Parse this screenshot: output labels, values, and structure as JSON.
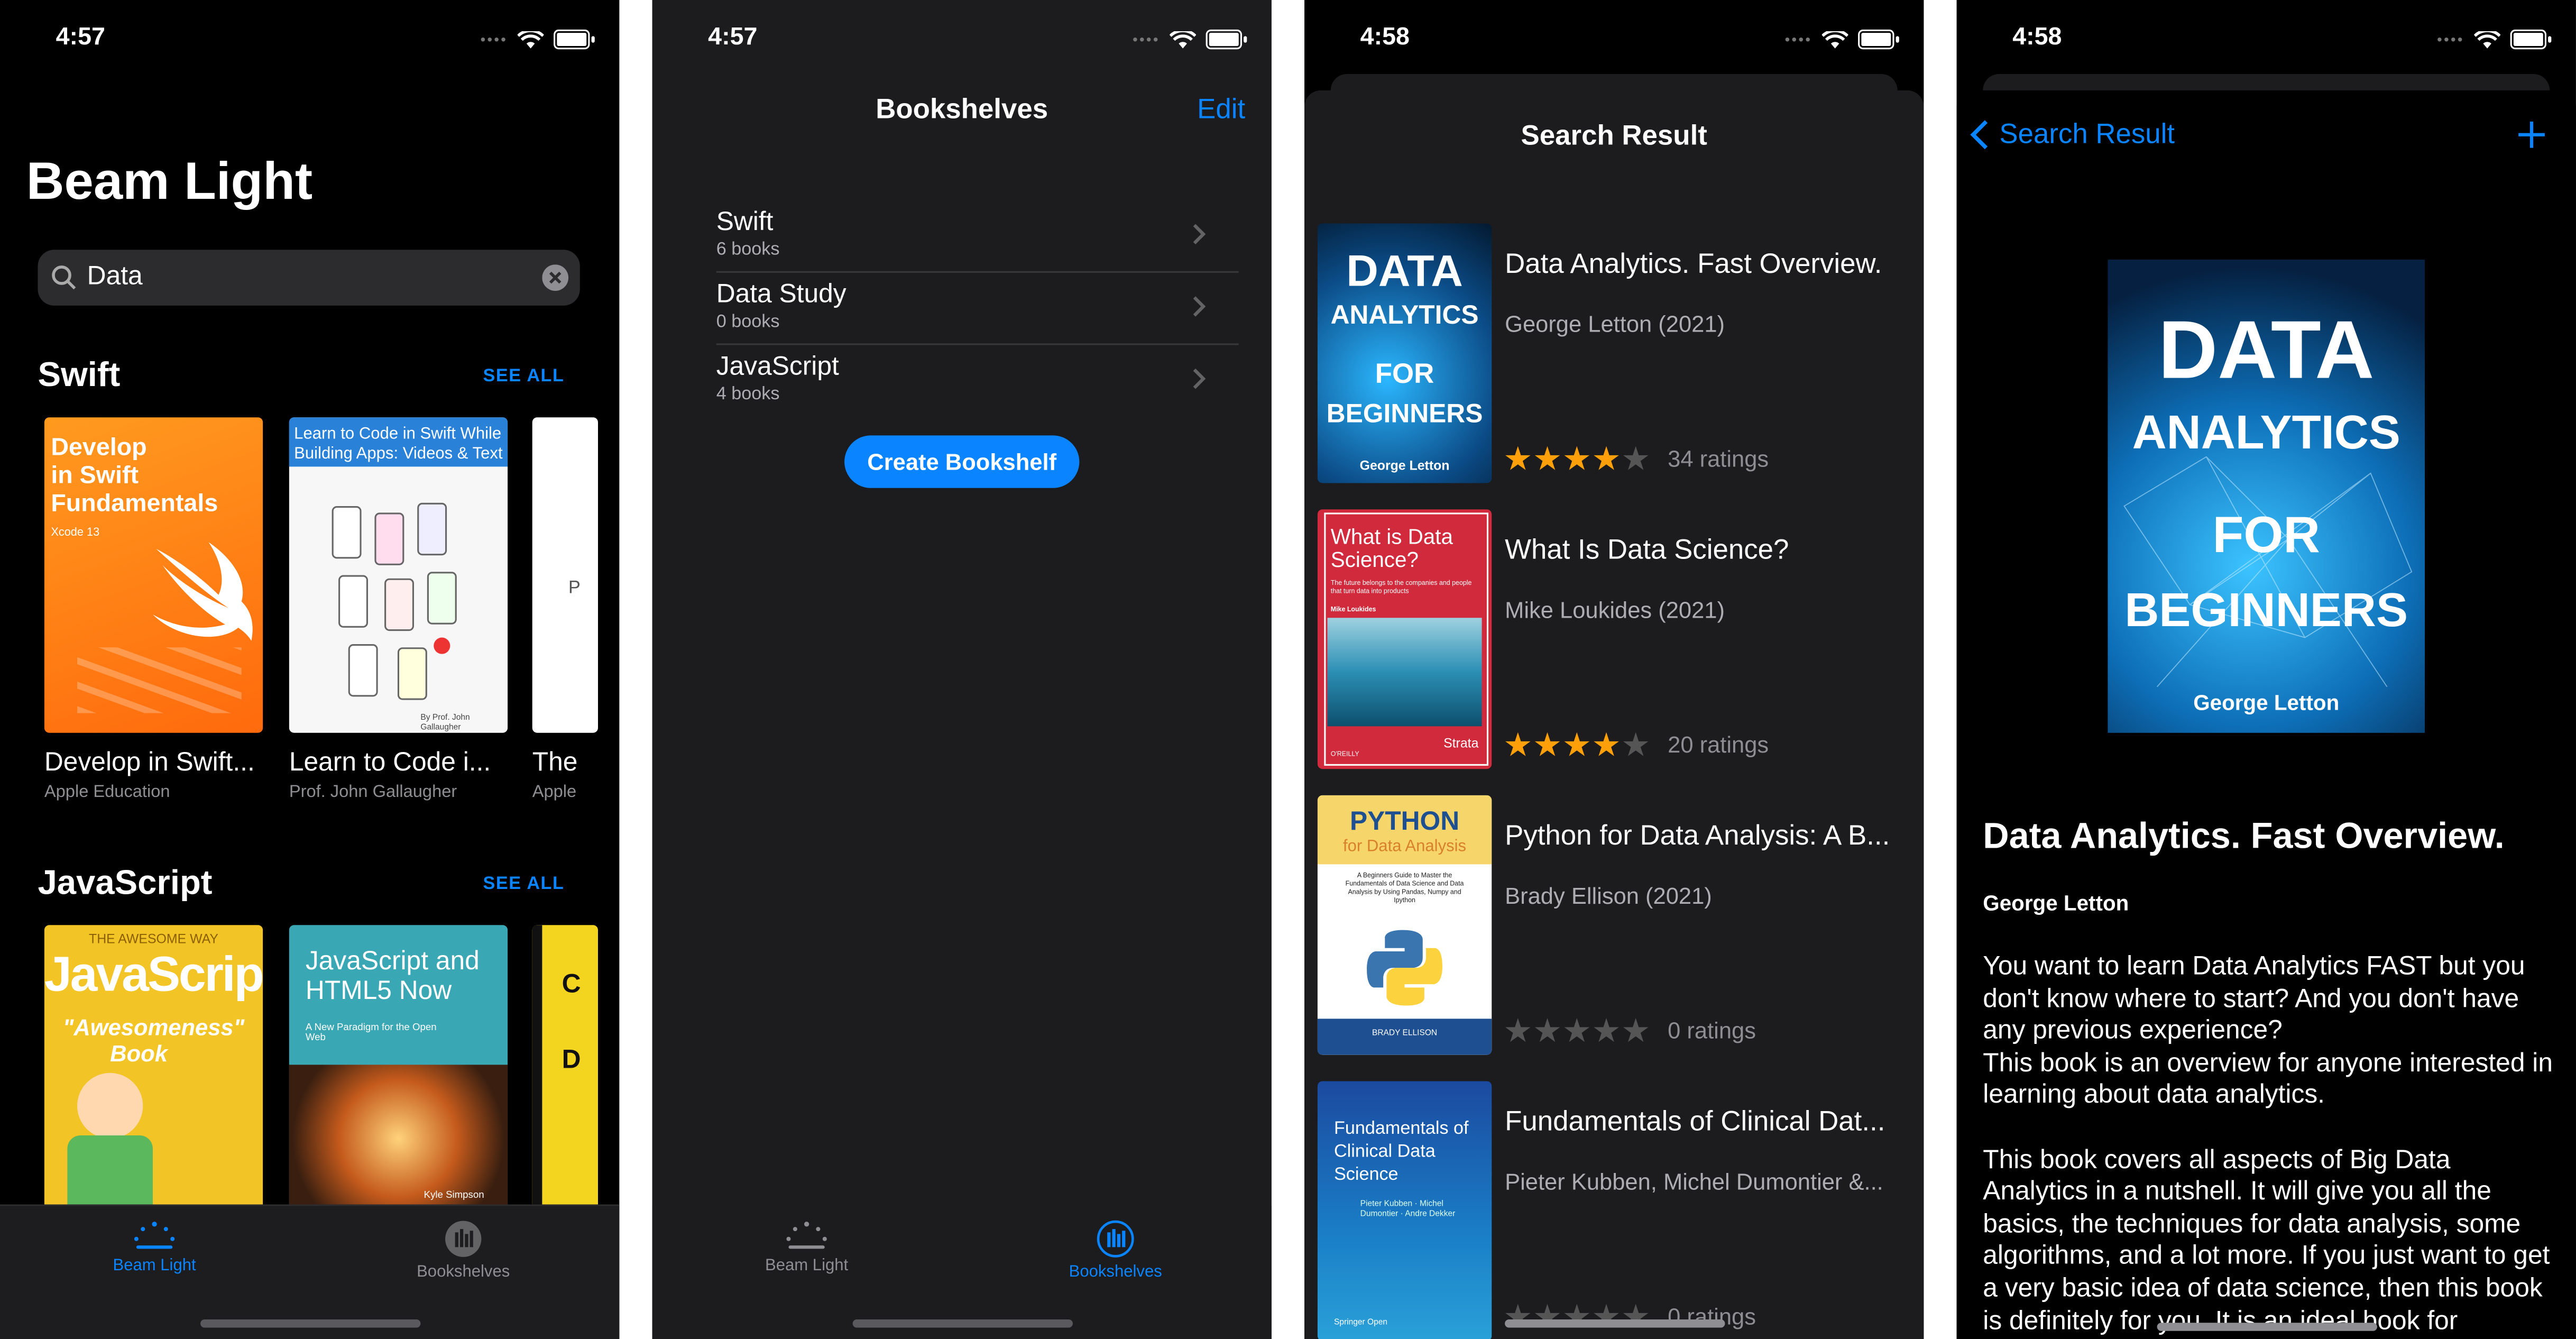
{
  "colors": {
    "accent": "#0a84ff",
    "star": "#ff9f0a",
    "background": "#000000",
    "card": "#1c1c1e"
  },
  "screen1": {
    "time": "4:57",
    "title": "Beam Light",
    "search_value": "Data",
    "sections": [
      {
        "title": "Swift",
        "see_all": "SEE ALL",
        "books": [
          {
            "title": "Develop in Swift...",
            "author": "Apple Education"
          },
          {
            "title": "Learn to Code i...",
            "author": "Prof. John Gallaugher"
          },
          {
            "title": "The",
            "author": "Apple"
          }
        ]
      },
      {
        "title": "JavaScript",
        "see_all": "SEE ALL"
      }
    ],
    "covers": {
      "swift": {
        "line1": "Develop",
        "line2": "in Swift",
        "line3": "Fundamentals",
        "edition": "Xcode 13"
      },
      "learn": {
        "line1": "Learn to Code in Swift While",
        "line2": "Building Apps: Videos & Text",
        "by": "By Prof. John Gallaugher"
      },
      "js1": {
        "top": "THE AWESOME WAY",
        "main": "JavaScript",
        "sub": "\"Awesomeness\"",
        "sub2": "Book"
      },
      "js2": {
        "main": "JavaScript and HTML5 Now",
        "sub": "A New Paradigm for the Open Web",
        "author": "Kyle Simpson"
      }
    },
    "tabs": [
      {
        "label": "Beam Light",
        "active": true
      },
      {
        "label": "Bookshelves",
        "active": false
      }
    ]
  },
  "screen2": {
    "time": "4:57",
    "title": "Bookshelves",
    "edit": "Edit",
    "shelves": [
      {
        "name": "Swift",
        "count": "6 books"
      },
      {
        "name": "Data Study",
        "count": "0 books"
      },
      {
        "name": "JavaScript",
        "count": "4 books"
      }
    ],
    "create_button": "Create Bookshelf",
    "tabs": [
      {
        "label": "Beam Light",
        "active": false
      },
      {
        "label": "Bookshelves",
        "active": true
      }
    ]
  },
  "screen3": {
    "time": "4:58",
    "title": "Search Result",
    "results": [
      {
        "title": "Data Analytics. Fast Overview.",
        "author": "George Letton (2021)",
        "stars": 4,
        "ratings": "34 ratings"
      },
      {
        "title": "What Is Data Science?",
        "author": "Mike Loukides (2021)",
        "stars": 4,
        "ratings": "20 ratings"
      },
      {
        "title": "Python for Data Analysis: A B...",
        "author": "Brady Ellison (2021)",
        "stars": 0,
        "ratings": "0 ratings"
      },
      {
        "title": "Fundamentals of Clinical Dat...",
        "author": "Pieter Kubben, Michel Dumontier &...",
        "stars": 0,
        "ratings": "0 ratings"
      }
    ],
    "covers": {
      "da": {
        "l1": "DATA",
        "l2": "ANALYTICS",
        "l3": "FOR",
        "l4": "BEGINNERS",
        "author": "George Letton"
      },
      "ds": {
        "title": "What is Data Science?",
        "sub": "The future belongs to the companies and people that turn data into products",
        "author": "Mike Loukides",
        "pub": "Strata",
        "pub2": "O'REILLY"
      },
      "py": {
        "l1": "PYTHON",
        "l2": "for Data Analysis",
        "sub": "A Beginners Guide to Master the Fundamentals of Data Science and Data Analysis by Using Pandas, Numpy and Ipython",
        "author": "BRADY ELLISON"
      },
      "cl": {
        "l1": "Fundamentals of",
        "l2": "Clinical Data Science",
        "authors": "Pieter Kubben · Michel Dumontier · Andre Dekker",
        "pub": "Springer Open"
      }
    }
  },
  "screen4": {
    "time": "4:58",
    "back": "Search Result",
    "cover": {
      "l1": "DATA",
      "l2": "ANALYTICS",
      "l3": "FOR",
      "l4": "BEGINNERS",
      "author": "George Letton"
    },
    "title": "Data Analytics. Fast Overview.",
    "author": "George Letton",
    "description": "You want to learn Data Analytics FAST but you don't know where to start? And you don't have any previous experience?\nThis book is an overview for anyone interested in learning about data analytics.\n\nThis book covers all aspects of Big Data Analytics in a nutshell. It will give you all the basics, the techniques for data analysis, some algorithms, and a lot more. If you just want to get a very basic idea of data science, then this book is definitely for you. It is an ideal book for"
  }
}
